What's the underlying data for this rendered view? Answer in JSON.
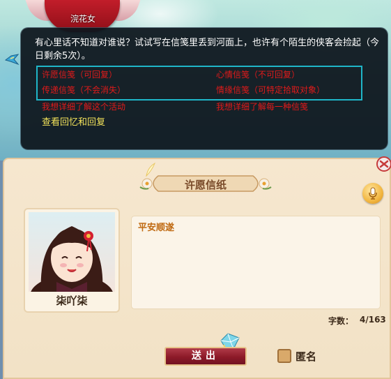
{
  "npc": {
    "name": "浣花女"
  },
  "dialog": {
    "message": "有心里话不知道对谁说？试试写在信笺里丢到河面上，也许有个陌生的侠客会捡起（今日剩余5次）。",
    "options": [
      {
        "label": "许愿信笺（可回复）"
      },
      {
        "label": "心情信笺（不可回复）"
      },
      {
        "label": "传递信笺（不会消失）"
      },
      {
        "label": "情缘信笺（可特定拾取对象）"
      }
    ],
    "info_links": [
      {
        "label": "我想详细了解这个活动"
      },
      {
        "label": "我想详细了解每一种信笺"
      }
    ],
    "review_link": "查看回忆和回复"
  },
  "letter": {
    "title": "许愿信纸",
    "sender_name": "柒吖柒",
    "content": "平安顺遂",
    "count_label": "字数：",
    "count_value": "4/163",
    "send_label": "送出",
    "anonymous_label": "匿名",
    "anonymous_checked": false
  },
  "colors": {
    "option_red": "#e01a1a",
    "link_yellow": "#f2e25a",
    "highlight_cyan": "#1fb6c8",
    "send_button": "#8c1a28",
    "content_orange": "#c06a12"
  }
}
